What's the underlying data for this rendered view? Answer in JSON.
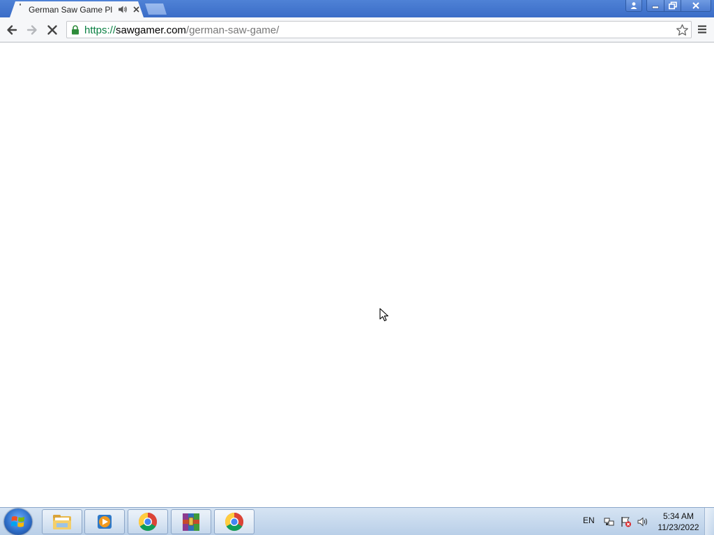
{
  "browser": {
    "tab": {
      "title": "German Saw Game Pla",
      "icons": [
        "audio-playing-icon",
        "close-icon"
      ]
    },
    "window_controls": [
      "profile-icon",
      "minimize-icon",
      "restore-icon",
      "close-icon"
    ],
    "toolbar": {
      "url_scheme": "https://",
      "url_host": "sawgamer.com",
      "url_path": "/german-saw-game/",
      "icons": [
        "back-arrow-icon",
        "forward-arrow-icon",
        "stop-loading-icon",
        "lock-icon",
        "bookmark-star-icon",
        "menu-icon"
      ]
    }
  },
  "taskbar": {
    "items": [
      "windows-start-icon",
      "file-explorer-icon",
      "media-player-icon",
      "chrome-icon",
      "winrar-icon",
      "chrome-icon"
    ],
    "language": "EN",
    "tray_icons": [
      "network-icon",
      "action-center-flag-icon",
      "volume-icon"
    ],
    "time": "5:34 AM",
    "date": "11/23/2022"
  },
  "colors": {
    "titlebar": "#3a6cc7",
    "url_scheme": "#0b8043",
    "taskbar": "#c3d6ec"
  }
}
